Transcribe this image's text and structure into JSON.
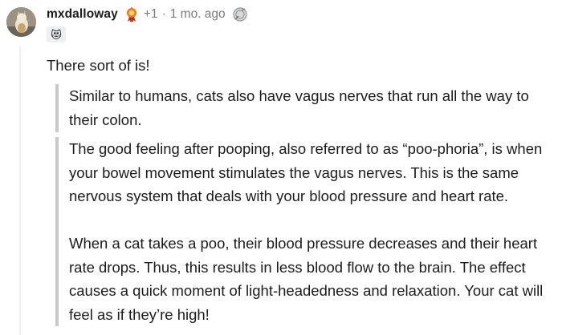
{
  "comment": {
    "username": "mxdalloway",
    "award_icon": "gold-award-icon",
    "score": "+1",
    "separator": "·",
    "time": "1 mo. ago",
    "coin_icon": "silver-coin-icon",
    "flair_icon": "smiling-cat-emoji",
    "flair_glyph": "😻",
    "body": "There sort of is!",
    "quotes": [
      "Similar to humans, cats also have vagus nerves that run all the way to their colon.",
      "The good feeling after pooping, also referred to as “poo-phoria”, is when your bowel movement stimulates the vagus nerves. This is the same nervous system that deals with your blood pressure and heart rate.",
      "When a cat takes a poo, their blood pressure decreases and their heart rate drops. Thus, this results in less blood flow to the brain. The effect causes a quick moment of light-headedness and relaxation. Your cat will feel as if they’re high!"
    ]
  },
  "colors": {
    "text": "#1c1c1c",
    "meta": "#787c7e",
    "quote_bar": "#c7c9cb",
    "thread_line": "#edeff1",
    "flair_bg": "#edeff1"
  }
}
